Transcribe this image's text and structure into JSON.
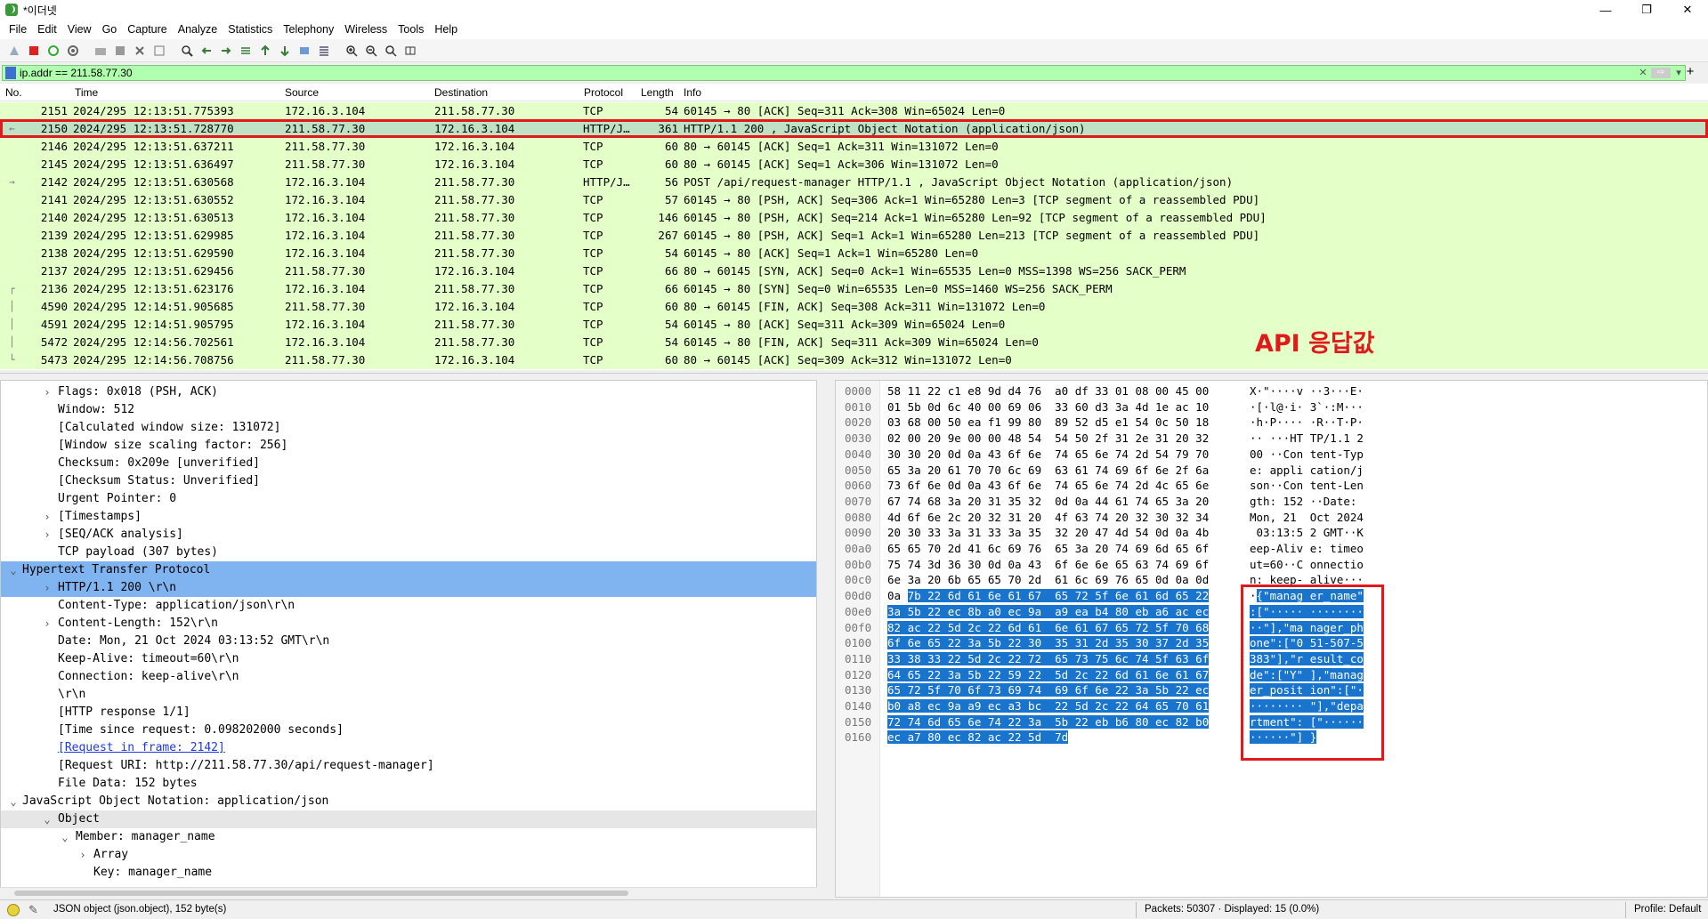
{
  "window": {
    "title": "*이더넷",
    "minimize": "—",
    "maximize": "❐",
    "close": "✕"
  },
  "menu": [
    "File",
    "Edit",
    "View",
    "Go",
    "Capture",
    "Analyze",
    "Statistics",
    "Telephony",
    "Wireless",
    "Tools",
    "Help"
  ],
  "filter": {
    "value": "ip.addr == 211.58.77.30",
    "add": "+"
  },
  "packet_list": {
    "columns": [
      "No.",
      "Time",
      "Source",
      "Destination",
      "Protocol",
      "Length",
      "Info"
    ],
    "rows": [
      {
        "no": "2151",
        "time": "2024/295 12:13:51.775393",
        "src": "172.16.3.104",
        "dst": "211.58.77.30",
        "proto": "TCP",
        "len": "54",
        "info": "60145 → 80 [ACK] Seq=311 Ack=308 Win=65024 Len=0",
        "glyph": ""
      },
      {
        "no": "2150",
        "time": "2024/295 12:13:51.728770",
        "src": "211.58.77.30",
        "dst": "172.16.3.104",
        "proto": "HTTP/J…",
        "len": "361",
        "info": "HTTP/1.1 200  , JavaScript Object Notation (application/json)",
        "glyph": "←",
        "selected": true
      },
      {
        "no": "2146",
        "time": "2024/295 12:13:51.637211",
        "src": "211.58.77.30",
        "dst": "172.16.3.104",
        "proto": "TCP",
        "len": "60",
        "info": "80 → 60145 [ACK] Seq=1 Ack=311 Win=131072 Len=0",
        "glyph": ""
      },
      {
        "no": "2145",
        "time": "2024/295 12:13:51.636497",
        "src": "211.58.77.30",
        "dst": "172.16.3.104",
        "proto": "TCP",
        "len": "60",
        "info": "80 → 60145 [ACK] Seq=1 Ack=306 Win=131072 Len=0",
        "glyph": ""
      },
      {
        "no": "2142",
        "time": "2024/295 12:13:51.630568",
        "src": "172.16.3.104",
        "dst": "211.58.77.30",
        "proto": "HTTP/J…",
        "len": "56",
        "info": "POST /api/request-manager HTTP/1.1 , JavaScript Object Notation (application/json)",
        "glyph": "→"
      },
      {
        "no": "2141",
        "time": "2024/295 12:13:51.630552",
        "src": "172.16.3.104",
        "dst": "211.58.77.30",
        "proto": "TCP",
        "len": "57",
        "info": "60145 → 80 [PSH, ACK] Seq=306 Ack=1 Win=65280 Len=3 [TCP segment of a reassembled PDU]",
        "glyph": ""
      },
      {
        "no": "2140",
        "time": "2024/295 12:13:51.630513",
        "src": "172.16.3.104",
        "dst": "211.58.77.30",
        "proto": "TCP",
        "len": "146",
        "info": "60145 → 80 [PSH, ACK] Seq=214 Ack=1 Win=65280 Len=92 [TCP segment of a reassembled PDU]",
        "glyph": ""
      },
      {
        "no": "2139",
        "time": "2024/295 12:13:51.629985",
        "src": "172.16.3.104",
        "dst": "211.58.77.30",
        "proto": "TCP",
        "len": "267",
        "info": "60145 → 80 [PSH, ACK] Seq=1 Ack=1 Win=65280 Len=213 [TCP segment of a reassembled PDU]",
        "glyph": ""
      },
      {
        "no": "2138",
        "time": "2024/295 12:13:51.629590",
        "src": "172.16.3.104",
        "dst": "211.58.77.30",
        "proto": "TCP",
        "len": "54",
        "info": "60145 → 80 [ACK] Seq=1 Ack=1 Win=65280 Len=0",
        "glyph": ""
      },
      {
        "no": "2137",
        "time": "2024/295 12:13:51.629456",
        "src": "211.58.77.30",
        "dst": "172.16.3.104",
        "proto": "TCP",
        "len": "66",
        "info": "80 → 60145 [SYN, ACK] Seq=0 Ack=1 Win=65535 Len=0 MSS=1398 WS=256 SACK_PERM",
        "glyph": ""
      },
      {
        "no": "2136",
        "time": "2024/295 12:13:51.623176",
        "src": "172.16.3.104",
        "dst": "211.58.77.30",
        "proto": "TCP",
        "len": "66",
        "info": "60145 → 80 [SYN] Seq=0 Win=65535 Len=0 MSS=1460 WS=256 SACK_PERM",
        "glyph": "┌"
      },
      {
        "no": "4590",
        "time": "2024/295 12:14:51.905685",
        "src": "211.58.77.30",
        "dst": "172.16.3.104",
        "proto": "TCP",
        "len": "60",
        "info": "80 → 60145 [FIN, ACK] Seq=308 Ack=311 Win=131072 Len=0",
        "glyph": "│"
      },
      {
        "no": "4591",
        "time": "2024/295 12:14:51.905795",
        "src": "172.16.3.104",
        "dst": "211.58.77.30",
        "proto": "TCP",
        "len": "54",
        "info": "60145 → 80 [ACK] Seq=311 Ack=309 Win=65024 Len=0",
        "glyph": "│"
      },
      {
        "no": "5472",
        "time": "2024/295 12:14:56.702561",
        "src": "172.16.3.104",
        "dst": "211.58.77.30",
        "proto": "TCP",
        "len": "54",
        "info": "60145 → 80 [FIN, ACK] Seq=311 Ack=309 Win=65024 Len=0",
        "glyph": "│"
      },
      {
        "no": "5473",
        "time": "2024/295 12:14:56.708756",
        "src": "211.58.77.30",
        "dst": "172.16.3.104",
        "proto": "TCP",
        "len": "60",
        "info": "80 → 60145 [ACK] Seq=309 Ack=312 Win=131072 Len=0",
        "glyph": "└"
      }
    ]
  },
  "annotation": {
    "label": "API 응답값"
  },
  "details": [
    {
      "indent": 1,
      "arrow": "›",
      "text": "Flags: 0x018 (PSH, ACK)"
    },
    {
      "indent": 1,
      "arrow": "",
      "text": "Window: 512"
    },
    {
      "indent": 1,
      "arrow": "",
      "text": "[Calculated window size: 131072]"
    },
    {
      "indent": 1,
      "arrow": "",
      "text": "[Window size scaling factor: 256]"
    },
    {
      "indent": 1,
      "arrow": "",
      "text": "Checksum: 0x209e [unverified]"
    },
    {
      "indent": 1,
      "arrow": "",
      "text": "[Checksum Status: Unverified]"
    },
    {
      "indent": 1,
      "arrow": "",
      "text": "Urgent Pointer: 0"
    },
    {
      "indent": 1,
      "arrow": "›",
      "text": "[Timestamps]"
    },
    {
      "indent": 1,
      "arrow": "›",
      "text": "[SEQ/ACK analysis]"
    },
    {
      "indent": 1,
      "arrow": "",
      "text": "TCP payload (307 bytes)"
    },
    {
      "indent": 0,
      "arrow": "⌄",
      "text": "Hypertext Transfer Protocol",
      "hl": "blue"
    },
    {
      "indent": 1,
      "arrow": "›",
      "text": "HTTP/1.1 200 \\r\\n",
      "hl": "blue"
    },
    {
      "indent": 1,
      "arrow": "",
      "text": "Content-Type: application/json\\r\\n"
    },
    {
      "indent": 1,
      "arrow": "›",
      "text": "Content-Length: 152\\r\\n"
    },
    {
      "indent": 1,
      "arrow": "",
      "text": "Date: Mon, 21 Oct 2024 03:13:52 GMT\\r\\n"
    },
    {
      "indent": 1,
      "arrow": "",
      "text": "Keep-Alive: timeout=60\\r\\n"
    },
    {
      "indent": 1,
      "arrow": "",
      "text": "Connection: keep-alive\\r\\n"
    },
    {
      "indent": 1,
      "arrow": "",
      "text": "\\r\\n"
    },
    {
      "indent": 1,
      "arrow": "",
      "text": "[HTTP response 1/1]"
    },
    {
      "indent": 1,
      "arrow": "",
      "text": "[Time since request: 0.098202000 seconds]"
    },
    {
      "indent": 1,
      "arrow": "",
      "text": "[Request in frame: 2142]",
      "link": true
    },
    {
      "indent": 1,
      "arrow": "",
      "text": "[Request URI: http://211.58.77.30/api/request-manager]"
    },
    {
      "indent": 1,
      "arrow": "",
      "text": "File Data: 152 bytes"
    },
    {
      "indent": 0,
      "arrow": "⌄",
      "text": "JavaScript Object Notation: application/json"
    },
    {
      "indent": 1,
      "arrow": "⌄",
      "text": "Object",
      "hl": "gray"
    },
    {
      "indent": 2,
      "arrow": "⌄",
      "text": "Member: manager_name"
    },
    {
      "indent": 3,
      "arrow": "›",
      "text": "Array"
    },
    {
      "indent": 3,
      "arrow": "",
      "text": "Key: manager_name"
    }
  ],
  "bytes": [
    {
      "off": "0000",
      "pre": "58 11 22 c1 e8 9d d4 76  a0 df 33 01 08 00 45 00",
      "hi": "",
      "asc_pre": "X·\"····v ··3···E·",
      "asc_hi": ""
    },
    {
      "off": "0010",
      "pre": "01 5b 0d 6c 40 00 69 06  33 60 d3 3a 4d 1e ac 10",
      "hi": "",
      "asc_pre": "·[·l@·i· 3`·:M···",
      "asc_hi": ""
    },
    {
      "off": "0020",
      "pre": "03 68 00 50 ea f1 99 80  89 52 d5 e1 54 0c 50 18",
      "hi": "",
      "asc_pre": "·h·P···· ·R··T·P·",
      "asc_hi": ""
    },
    {
      "off": "0030",
      "pre": "02 00 20 9e 00 00 48 54  54 50 2f 31 2e 31 20 32",
      "hi": "",
      "asc_pre": "·· ···HT TP/1.1 2",
      "asc_hi": ""
    },
    {
      "off": "0040",
      "pre": "30 30 20 0d 0a 43 6f 6e  74 65 6e 74 2d 54 79 70",
      "hi": "",
      "asc_pre": "00 ··Con tent-Typ",
      "asc_hi": ""
    },
    {
      "off": "0050",
      "pre": "65 3a 20 61 70 70 6c 69  63 61 74 69 6f 6e 2f 6a",
      "hi": "",
      "asc_pre": "e: appli cation/j",
      "asc_hi": ""
    },
    {
      "off": "0060",
      "pre": "73 6f 6e 0d 0a 43 6f 6e  74 65 6e 74 2d 4c 65 6e",
      "hi": "",
      "asc_pre": "son··Con tent-Len",
      "asc_hi": ""
    },
    {
      "off": "0070",
      "pre": "67 74 68 3a 20 31 35 32  0d 0a 44 61 74 65 3a 20",
      "hi": "",
      "asc_pre": "gth: 152 ··Date: ",
      "asc_hi": ""
    },
    {
      "off": "0080",
      "pre": "4d 6f 6e 2c 20 32 31 20  4f 63 74 20 32 30 32 34",
      "hi": "",
      "asc_pre": "Mon, 21  Oct 2024",
      "asc_hi": ""
    },
    {
      "off": "0090",
      "pre": "20 30 33 3a 31 33 3a 35  32 20 47 4d 54 0d 0a 4b",
      "hi": "",
      "asc_pre": " 03:13:5 2 GMT··K",
      "asc_hi": ""
    },
    {
      "off": "00a0",
      "pre": "65 65 70 2d 41 6c 69 76  65 3a 20 74 69 6d 65 6f",
      "hi": "",
      "asc_pre": "eep-Aliv e: timeo",
      "asc_hi": ""
    },
    {
      "off": "00b0",
      "pre": "75 74 3d 36 30 0d 0a 43  6f 6e 6e 65 63 74 69 6f",
      "hi": "",
      "asc_pre": "ut=60··C onnectio",
      "asc_hi": ""
    },
    {
      "off": "00c0",
      "pre": "6e 3a 20 6b 65 65 70 2d  61 6c 69 76 65 0d 0a 0d",
      "hi": "",
      "asc_pre": "n: keep- alive···",
      "asc_hi": ""
    },
    {
      "off": "00d0",
      "pre": "0a ",
      "hi": "7b 22 6d 61 6e 61 67  65 72 5f 6e 61 6d 65 22",
      "asc_pre": "·",
      "asc_hi": "{\"manag er_name\""
    },
    {
      "off": "00e0",
      "pre": "",
      "hi": "3a 5b 22 ec 8b a0 ec 9a  a9 ea b4 80 eb a6 ac ec",
      "asc_pre": "",
      "asc_hi": ":[\"····· ········"
    },
    {
      "off": "00f0",
      "pre": "",
      "hi": "82 ac 22 5d 2c 22 6d 61  6e 61 67 65 72 5f 70 68",
      "asc_pre": "",
      "asc_hi": "··\"],\"ma nager_ph"
    },
    {
      "off": "0100",
      "pre": "",
      "hi": "6f 6e 65 22 3a 5b 22 30  35 31 2d 35 30 37 2d 35",
      "asc_pre": "",
      "asc_hi": "one\":[\"0 51-507-5"
    },
    {
      "off": "0110",
      "pre": "",
      "hi": "33 38 33 22 5d 2c 22 72  65 73 75 6c 74 5f 63 6f",
      "asc_pre": "",
      "asc_hi": "383\"],\"r esult_co"
    },
    {
      "off": "0120",
      "pre": "",
      "hi": "64 65 22 3a 5b 22 59 22  5d 2c 22 6d 61 6e 61 67",
      "asc_pre": "",
      "asc_hi": "de\":[\"Y\" ],\"manag"
    },
    {
      "off": "0130",
      "pre": "",
      "hi": "65 72 5f 70 6f 73 69 74  69 6f 6e 22 3a 5b 22 ec",
      "asc_pre": "",
      "asc_hi": "er_posit ion\":[\"·"
    },
    {
      "off": "0140",
      "pre": "",
      "hi": "b0 a8 ec 9a a9 ec a3 bc  22 5d 2c 22 64 65 70 61",
      "asc_pre": "",
      "asc_hi": "········ \"],\"depa"
    },
    {
      "off": "0150",
      "pre": "",
      "hi": "72 74 6d 65 6e 74 22 3a  5b 22 eb b6 80 ec 82 b0",
      "asc_pre": "",
      "asc_hi": "rtment\": [\"······"
    },
    {
      "off": "0160",
      "pre": "",
      "hi": "ec a7 80 ec 82 ac 22 5d  7d",
      "asc_pre": "",
      "asc_hi": "······\"] }"
    }
  ],
  "status": {
    "left": "JSON object (json.object), 152 byte(s)",
    "middle": "Packets: 50307 · Displayed: 15 (0.0%)",
    "right": "Profile: Default"
  }
}
